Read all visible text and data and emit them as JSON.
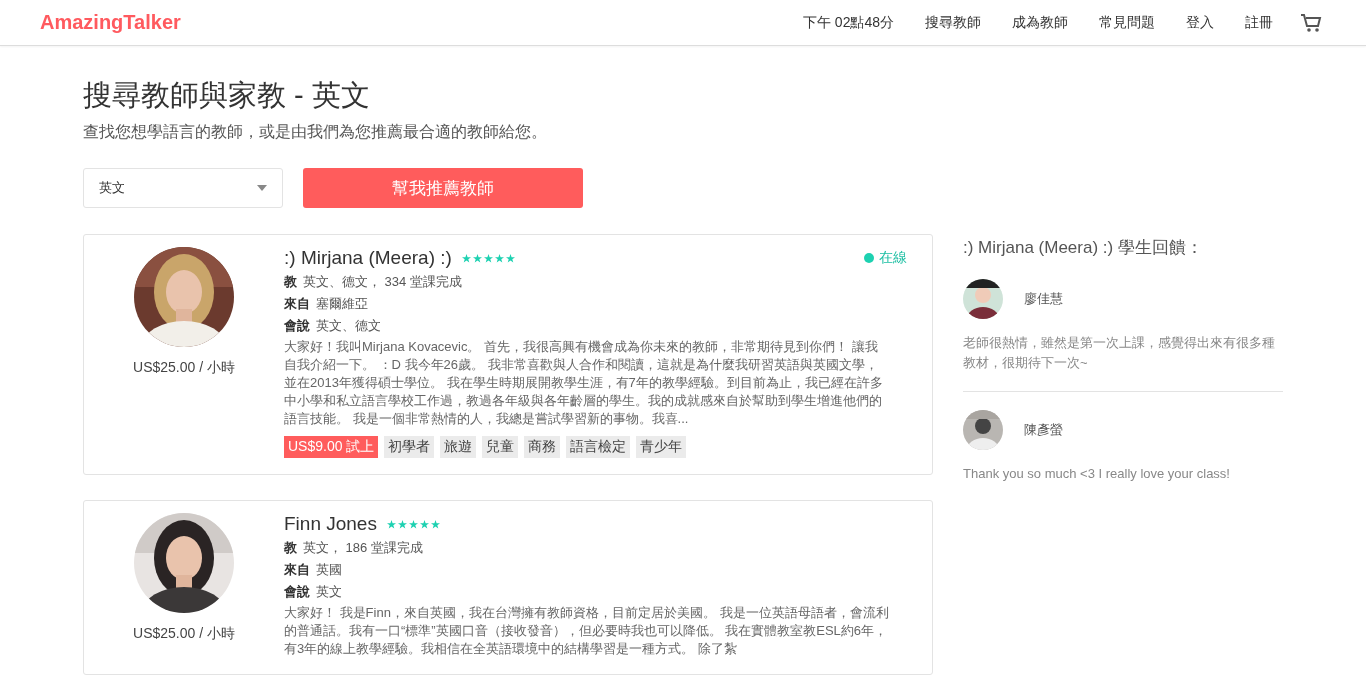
{
  "header": {
    "logo": "AmazingTalker",
    "time": "下午 02點48分",
    "nav": [
      "搜尋教師",
      "成為教師",
      "常見問題",
      "登入",
      "註冊"
    ]
  },
  "page": {
    "title": "搜尋教師與家教 - 英文",
    "subtitle": "查找您想學語言的教師，或是由我們為您推薦最合適的教師給您。"
  },
  "filter": {
    "language": "英文",
    "button": "幫我推薦教師"
  },
  "teachers": [
    {
      "name": ":) Mirjana (Meera) :)",
      "stars": 5,
      "online": true,
      "status": "在線",
      "price": "US$25.00 / 小時",
      "teaches_label": "教",
      "teaches": "英文、德文， 334 堂課完成",
      "from_label": "來自",
      "from": "塞爾維亞",
      "speaks_label": "會說",
      "speaks": "英文、德文",
      "bio": "大家好！我叫Mirjana Kovacevic。 首先，我很高興有機會成為你未來的教師，非常期待見到你們！ 讓我自我介紹一下。 ：D 我今年26歲。 我非常喜歡與人合作和閱讀，這就是為什麼我研習英語與英國文學，並在2013年獲得碩士學位。 我在學生時期展開教學生涯，有7年的教學經驗。到目前為止，我已經在許多中小學和私立語言學校工作過，教過各年級與各年齡層的學生。我的成就感來自於幫助到學生增進他們的語言技能。 我是一個非常熱情的人，我總是嘗試學習新的事物。我喜...",
      "trial": "US$9.00 試上",
      "tags": [
        "初學者",
        "旅遊",
        "兒童",
        "商務",
        "語言檢定",
        "青少年"
      ]
    },
    {
      "name": "Finn Jones",
      "stars": 5,
      "online": false,
      "price": "US$25.00 / 小時",
      "teaches_label": "教",
      "teaches": "英文， 186 堂課完成",
      "from_label": "來自",
      "from": "英國",
      "speaks_label": "會說",
      "speaks": "英文",
      "bio": "大家好！ 我是Finn，來自英國，我在台灣擁有教師資格，目前定居於美國。 我是一位英語母語者，會流利的普通話。我有一口“標準”英國口音（接收發音），但必要時我也可以降低。 我在實體教室教ESL約6年，有3年的線上教學經驗。我相信在全英語環境中的結構學習是一種方式。 除了紮"
    }
  ],
  "reviews": {
    "title": ":) Mirjana (Meera) :) 學生回饋：",
    "items": [
      {
        "name": "廖佳慧",
        "text": "老師很熱情，雖然是第一次上課，感覺得出來有很多種教材，很期待下一次~"
      },
      {
        "name": "陳彥螢",
        "text": "Thank you so much <3 I really love your class!"
      }
    ]
  }
}
